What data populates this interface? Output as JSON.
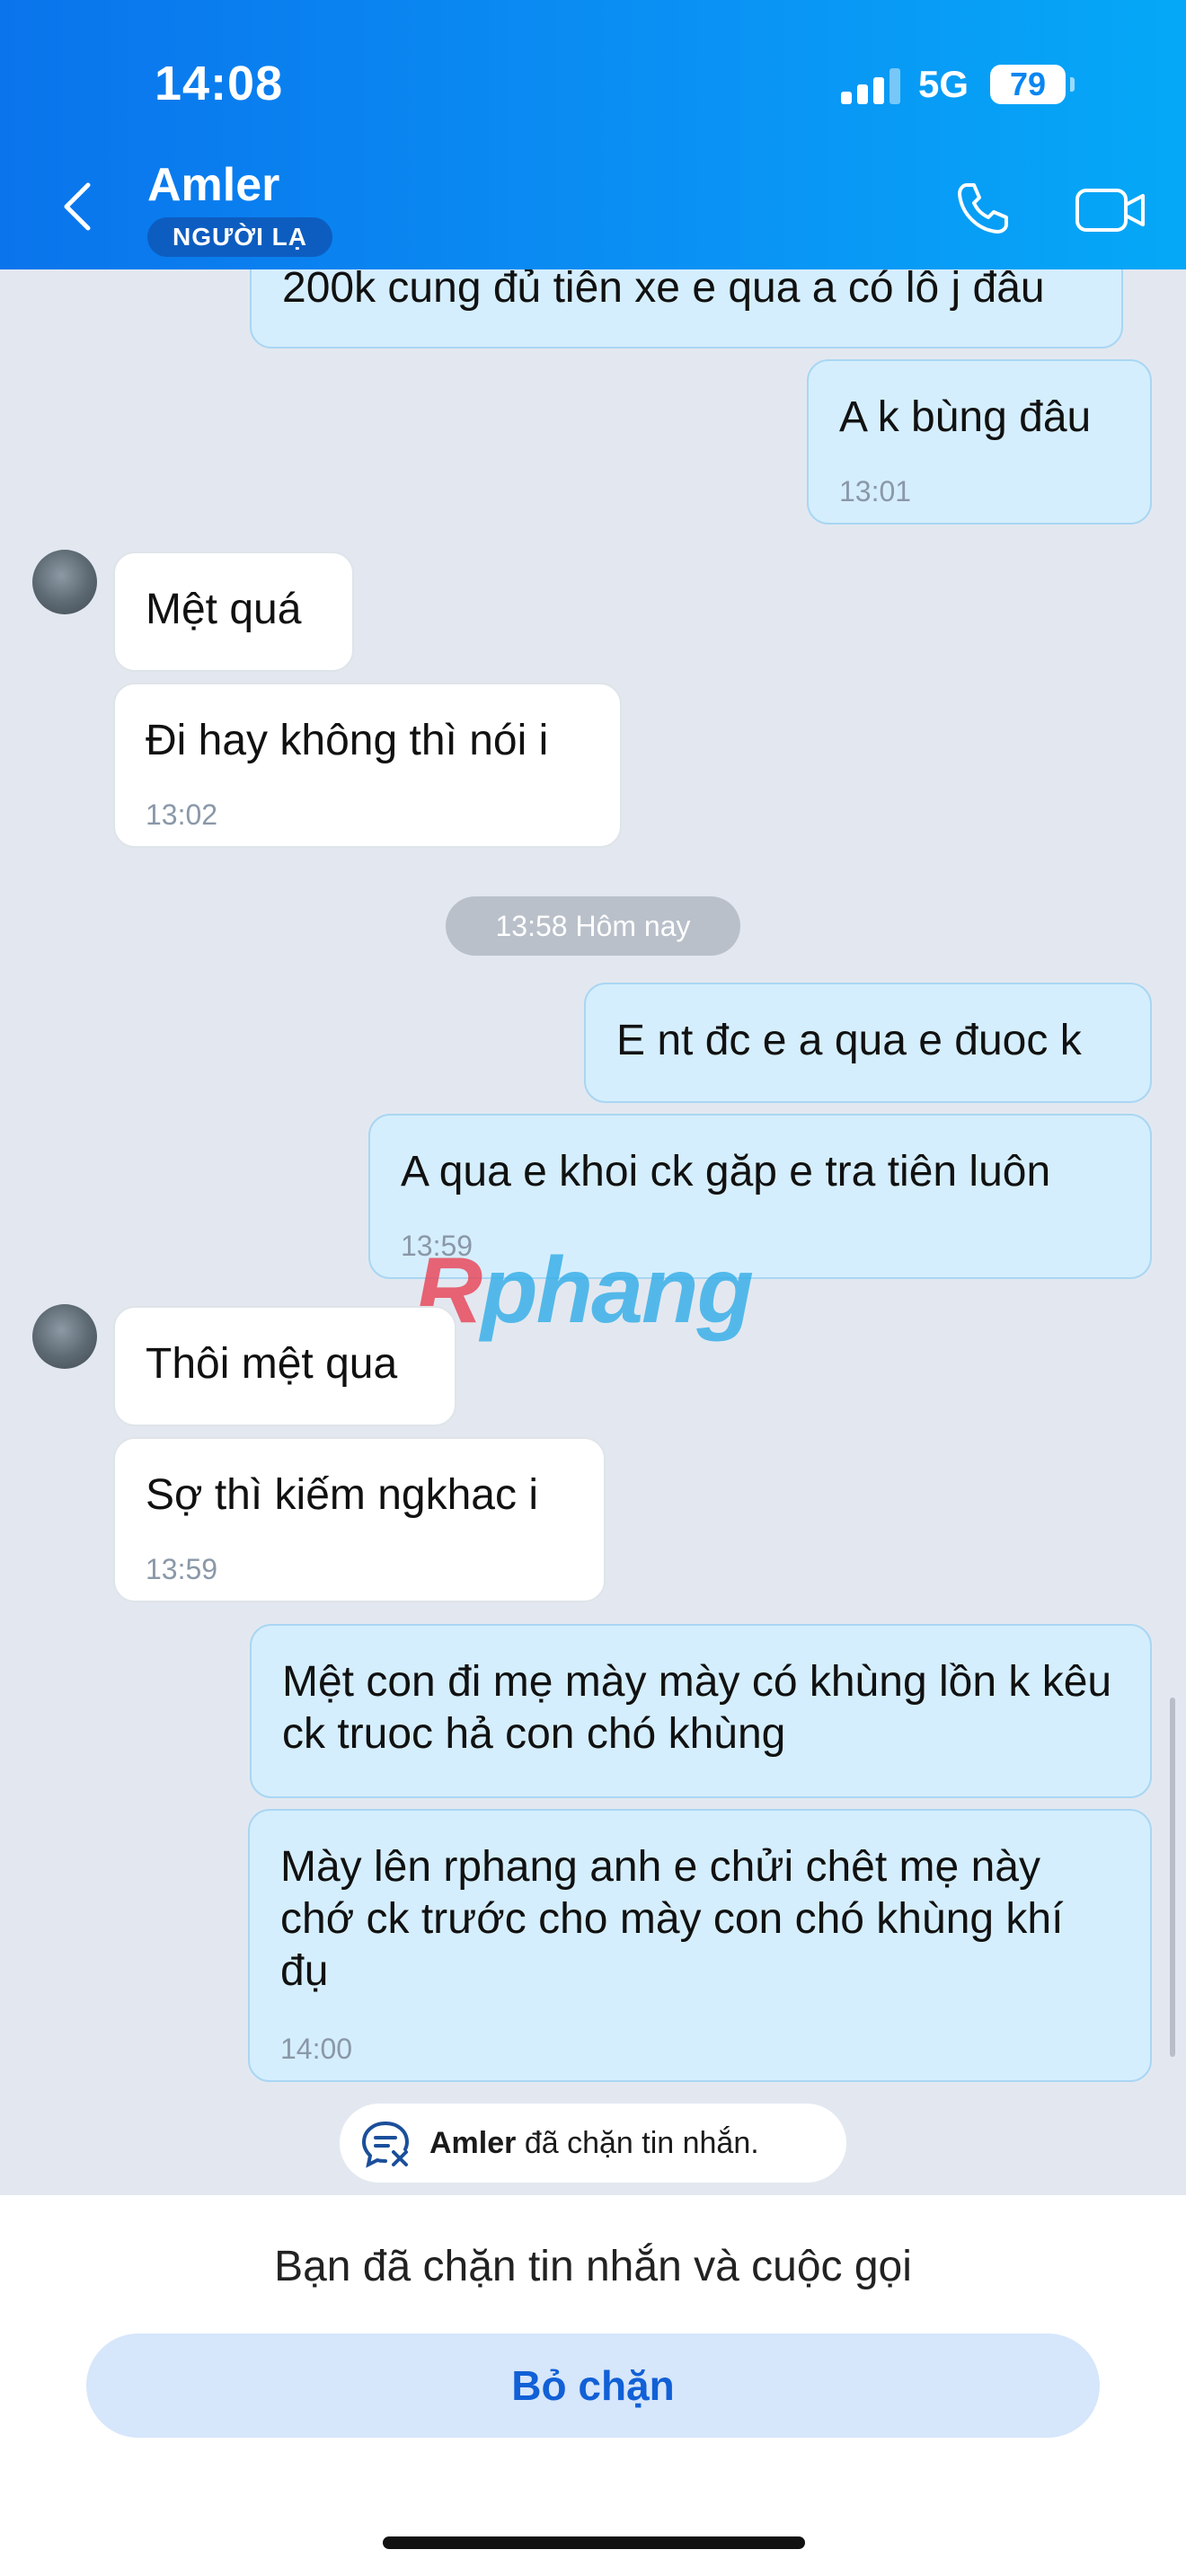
{
  "status_bar": {
    "time": "14:08",
    "network": "5G",
    "battery": "79"
  },
  "header": {
    "title": "Amler",
    "badge": "NGƯỜI LẠ"
  },
  "messages": [
    {
      "text": "200k cung đủ tiên xe e qua a có lô j đâu",
      "time": ""
    },
    {
      "text": "A k bùng đâu",
      "time": "13:01"
    },
    {
      "text": "Mệt quá",
      "time": ""
    },
    {
      "text": "Đi hay không thì nói i",
      "time": "13:02"
    },
    {
      "text": "E nt đc e a qua e đuoc k",
      "time": ""
    },
    {
      "text": "A qua e khoi ck găp e tra tiên luôn",
      "time": "13:59"
    },
    {
      "text": "Thôi mệt qua",
      "time": ""
    },
    {
      "text": "Sợ thì kiếm ngkhac i",
      "time": "13:59"
    },
    {
      "text": "Mệt con đi mẹ mày mày có khùng lồn k kêu ck truoc hả con chó khùng",
      "time": ""
    },
    {
      "text": "Mày lên rphang anh e chửi chêt mẹ này chớ ck trước cho mày con chó khùng khí đụ",
      "time": "14:00"
    }
  ],
  "divider": "13:58 Hôm nay",
  "watermark": {
    "part1": "R",
    "part2": "phang"
  },
  "blocked_notice": {
    "name": "Amler",
    "text": " đã chặn tin nhắn."
  },
  "bottom": {
    "text": "Bạn đã chặn tin nhắn và cuộc gọi",
    "unblock_label": "Bỏ chặn"
  },
  "colors": {
    "header": "#0a86f0",
    "my_bubble": "#d5eefd",
    "accent": "#1160d6"
  },
  "icons": [
    "back-chevron-icon",
    "phone-icon",
    "video-call-icon",
    "blocked-message-icon"
  ]
}
